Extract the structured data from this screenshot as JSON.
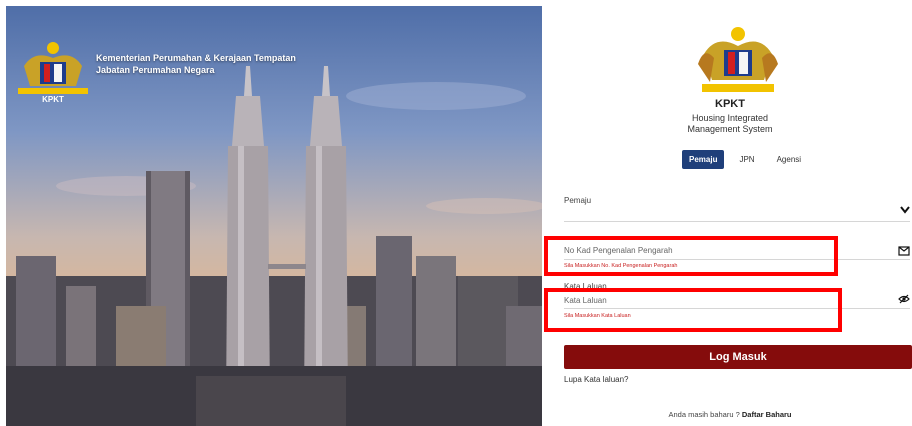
{
  "hero": {
    "org_line1": "Kementerian Perumahan & Kerajaan Tempatan",
    "org_line2": "Jabatan Perumahan Negara",
    "logo_text": "KPKT"
  },
  "panel": {
    "logo_text": "KPKT",
    "system_line1": "Housing Integrated",
    "system_line2": "Management System",
    "tabs": [
      {
        "label": "Pemaju",
        "active": true
      },
      {
        "label": "JPN",
        "active": false
      },
      {
        "label": "Agensi",
        "active": false
      }
    ],
    "category_label": "Pemaju",
    "id_field": {
      "placeholder": "No Kad Pengenalan Pengarah",
      "error": "Sila Masukkan No. Kad Pengenalan Pengarah"
    },
    "password_label": "Kata Laluan",
    "password_field": {
      "placeholder": "Kata Laluan",
      "error": "Sila Masukkan Kata Laluan"
    },
    "login_button": "Log Masuk",
    "forgot_link": "Lupa Kata laluan?",
    "signup_prompt": "Anda masih baharu ?",
    "signup_link": "Daftar Baharu"
  },
  "colors": {
    "primary_button": "#850c0c",
    "active_tab": "#1f3f7a",
    "error_text": "#c81e1e",
    "highlight": "#ff0000"
  },
  "icons": [
    "chevron-down-icon",
    "envelope-icon",
    "eye-slash-icon",
    "kpkt-crest-icon"
  ]
}
